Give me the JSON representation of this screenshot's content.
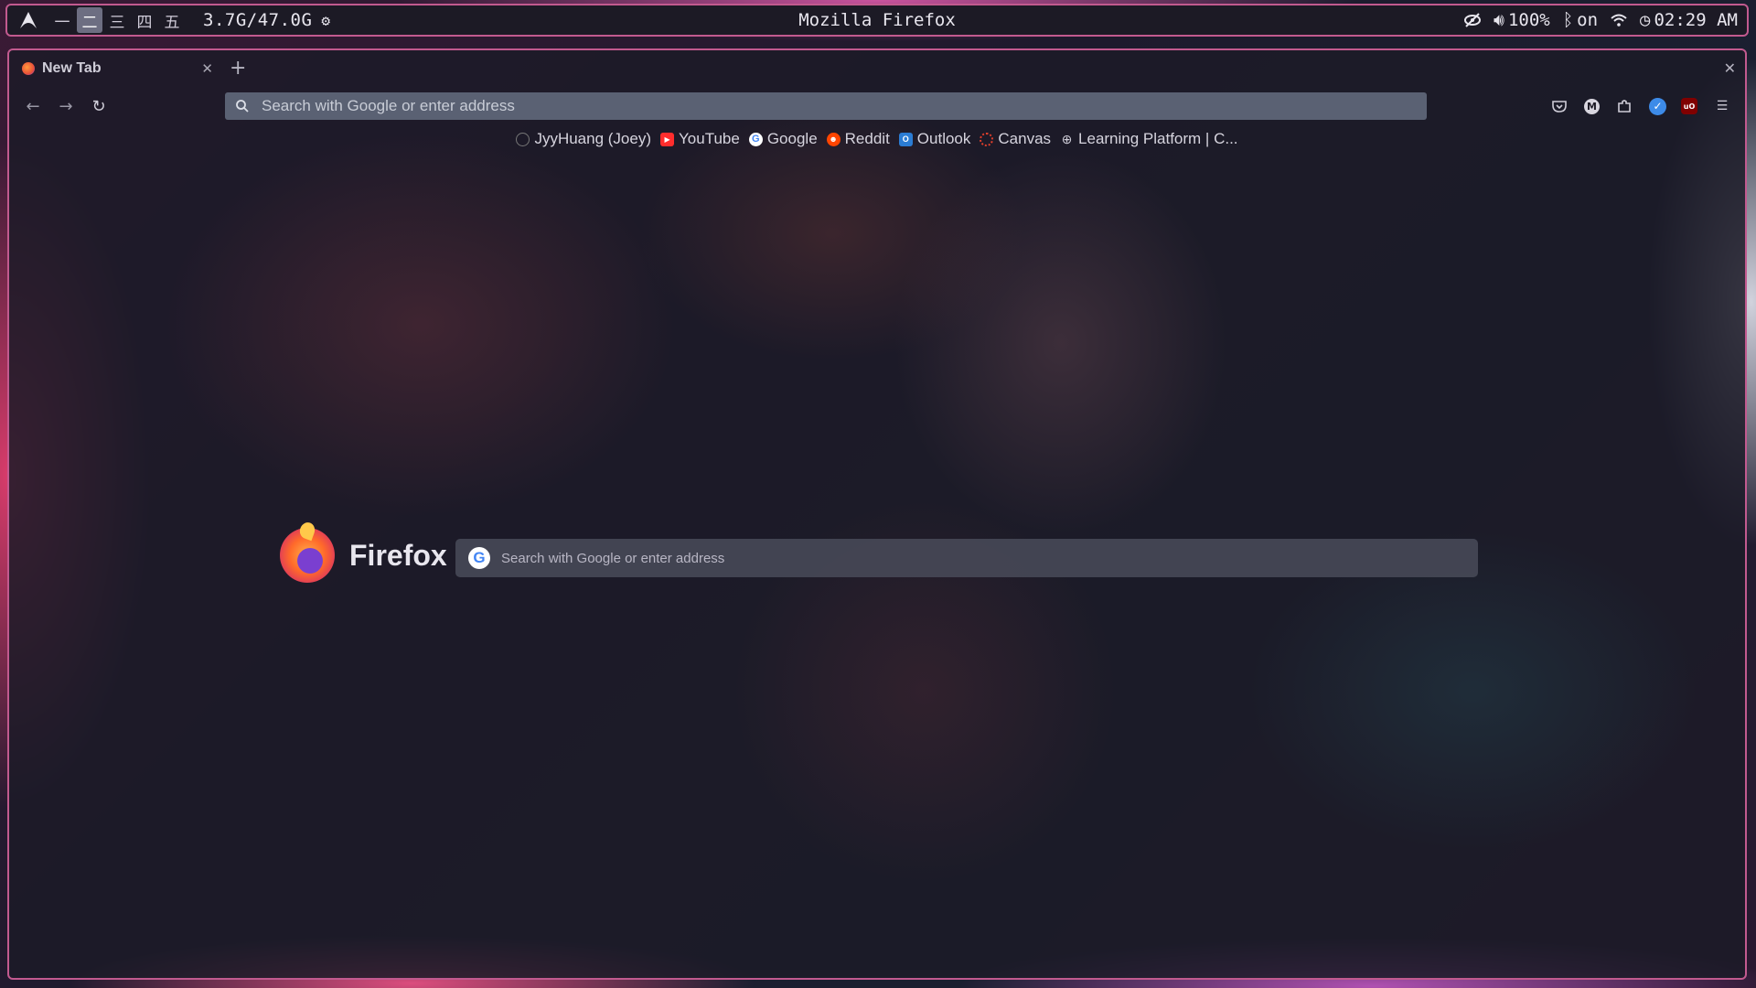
{
  "topbar": {
    "workspaces": [
      "一",
      "二",
      "三",
      "四",
      "五"
    ],
    "active_workspace": 1,
    "memory": "3.7G/47.0G",
    "window_title": "Mozilla Firefox",
    "volume": "100%",
    "bluetooth": "on",
    "time": "02:29 AM"
  },
  "browser": {
    "tab_title": "New Tab",
    "url_placeholder": "Search with Google or enter address",
    "bookmarks": [
      {
        "label": "JyyHuang (Joey)",
        "icon": "github-icon"
      },
      {
        "label": "YouTube",
        "icon": "youtube-icon",
        "color": "#ff2d2d"
      },
      {
        "label": "Google",
        "icon": "google-icon"
      },
      {
        "label": "Reddit",
        "icon": "reddit-icon",
        "color": "#ff4500"
      },
      {
        "label": "Outlook",
        "icon": "outlook-icon",
        "color": "#2b7cd3"
      },
      {
        "label": "Canvas",
        "icon": "canvas-icon",
        "color": "#e13f2b"
      },
      {
        "label": "Learning Platform | C...",
        "icon": "globe-icon"
      }
    ]
  },
  "newtab": {
    "brand": "Firefox",
    "search_placeholder": "Search with Google or enter address"
  }
}
